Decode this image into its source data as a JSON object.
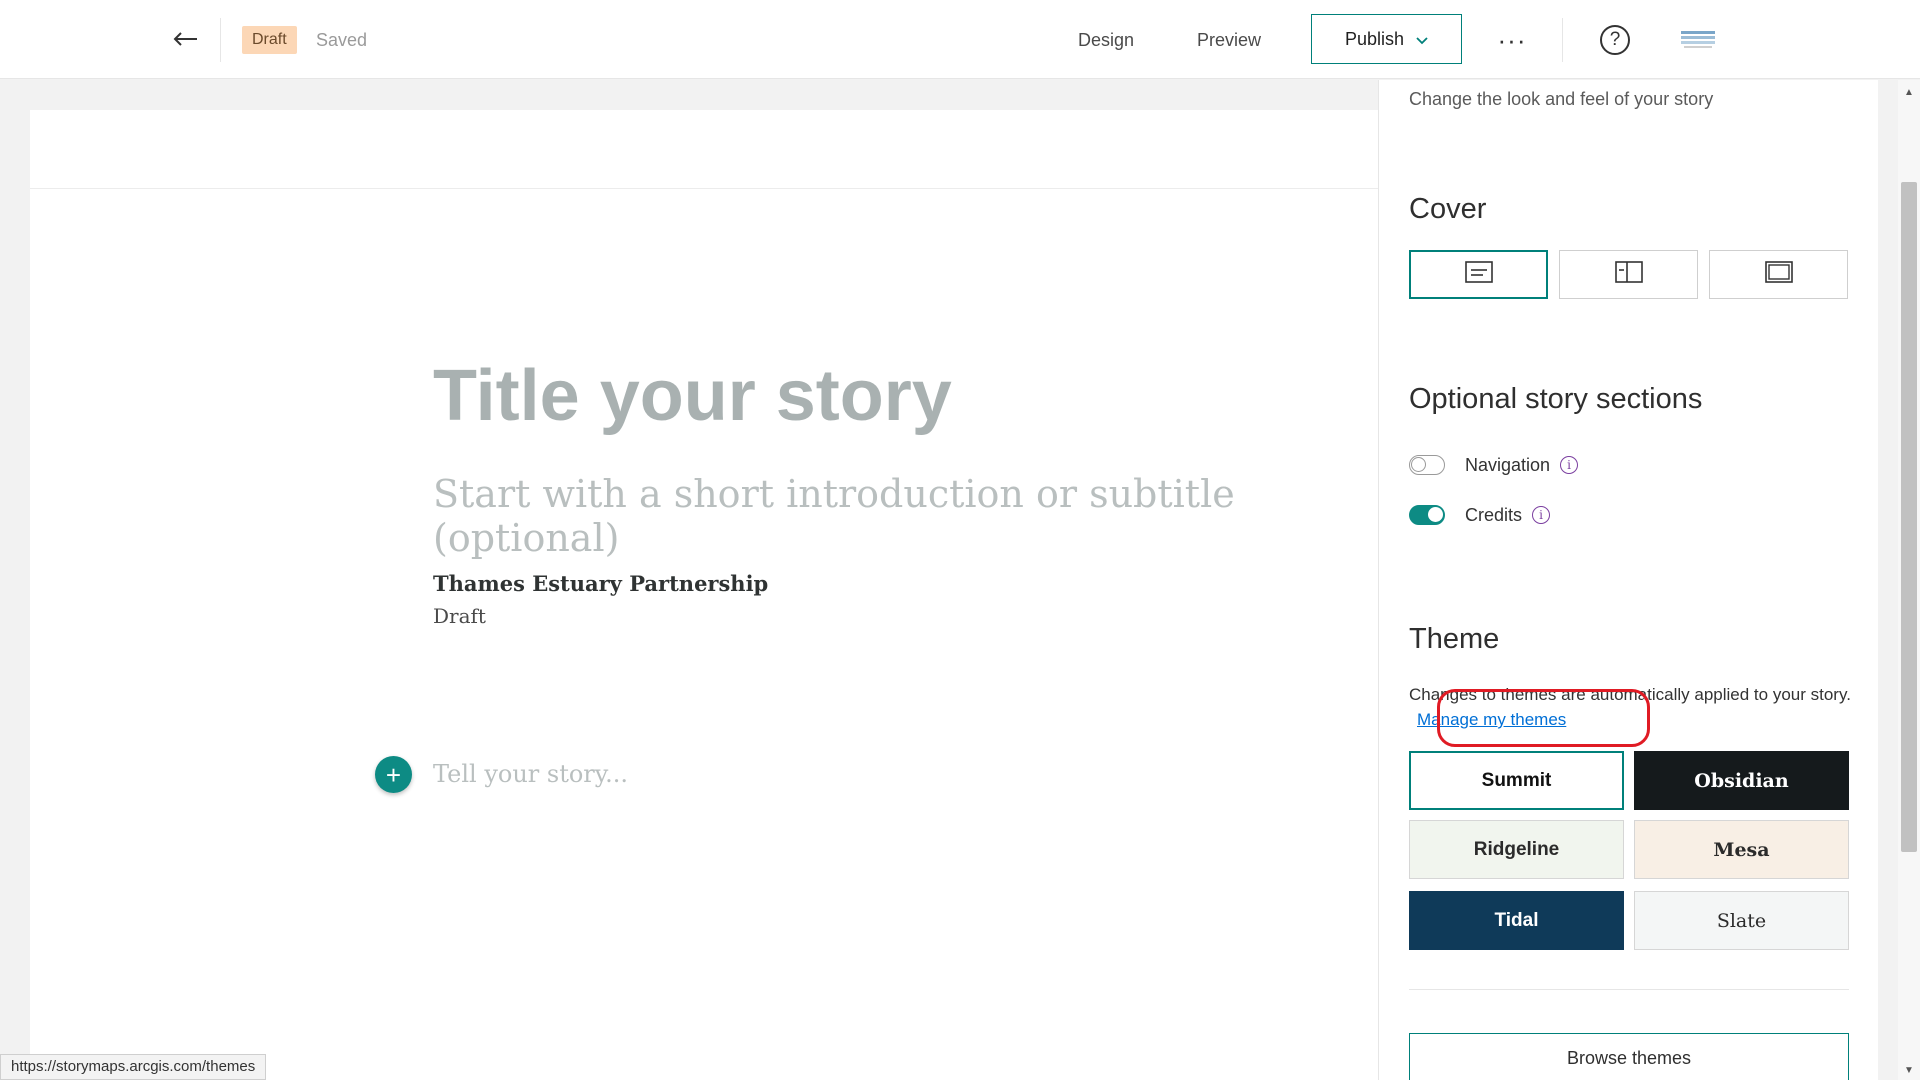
{
  "topbar": {
    "back_icon": "arrow-left-icon",
    "draft_badge": "Draft",
    "saved_status": "Saved",
    "design_label": "Design",
    "preview_label": "Preview",
    "publish_label": "Publish",
    "more_label": "···",
    "help_label": "?"
  },
  "story": {
    "title_placeholder": "Title your story",
    "subtitle_placeholder": "Start with a short introduction or subtitle (optional)",
    "byline": "Thames Estuary Partnership",
    "byline_status": "Draft",
    "add_block_label": "+",
    "body_placeholder": "Tell your story..."
  },
  "panel": {
    "description": "Change the look and feel of your story",
    "cover_heading": "Cover",
    "cover_options": [
      "minimal-cover-icon",
      "sidebyside-cover-icon",
      "full-cover-icon"
    ],
    "sections_heading": "Optional story sections",
    "navigation_label": "Navigation",
    "navigation_on": false,
    "credits_label": "Credits",
    "credits_on": true,
    "info_glyph": "i",
    "theme_heading": "Theme",
    "theme_desc": "Changes to themes are automatically applied to your story.",
    "manage_themes_link": "Manage my themes",
    "themes": [
      {
        "name": "Summit",
        "bg": "#ffffff",
        "fg": "#111111",
        "selected": true
      },
      {
        "name": "Obsidian",
        "bg": "#151a1c",
        "fg": "#ffffff",
        "selected": false
      },
      {
        "name": "Ridgeline",
        "bg": "#f1f5ee",
        "fg": "#2b2b2b",
        "selected": false
      },
      {
        "name": "Mesa",
        "bg": "#f8efe5",
        "fg": "#2b2b2b",
        "selected": false
      },
      {
        "name": "Tidal",
        "bg": "#0f3a59",
        "fg": "#ffffff",
        "selected": false
      },
      {
        "name": "Slate",
        "bg": "#f4f6f6",
        "fg": "#2b2b2b",
        "selected": false
      }
    ],
    "browse_themes_label": "Browse themes"
  },
  "status_bar": {
    "url": "https://storymaps.arcgis.com/themes"
  },
  "colors": {
    "accent": "#00807a",
    "toggle_on": "#0d8b84",
    "link": "#006fd6",
    "highlight": "#e01b24",
    "draft_badge_bg": "#fcd7b6"
  }
}
